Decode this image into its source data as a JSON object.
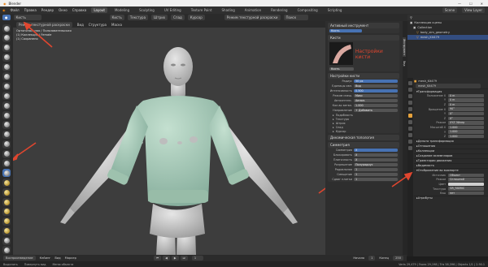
{
  "titlebar": {
    "title": "Blender",
    "controls": [
      "—",
      "☐",
      "✕"
    ]
  },
  "menubar": {
    "menus": [
      "Файл",
      "Правка",
      "Рендер",
      "Окно",
      "Справка"
    ],
    "workspaces": [
      "Layout",
      "Modeling",
      "Sculpting",
      "UV Editing",
      "Texture Paint",
      "Shading",
      "Animation",
      "Rendering",
      "Compositing",
      "Scripting"
    ],
    "active_workspace": "Layout",
    "scene": "Scene",
    "view_layer": "View Layer"
  },
  "header": {
    "brush_name": "Кисть",
    "mode": "Режим текстурной раскраски",
    "search": "Поиск",
    "items": [
      "Кисть",
      "Текстура",
      "Штрих",
      "Спад",
      "Курсор"
    ]
  },
  "viewport": {
    "header_tabs": [
      "Режим текстурной раскраски",
      "Вид",
      "Структура",
      "Маска"
    ],
    "info_lines": [
      "Ортогональная / Пользовательская",
      "(1) Коллекция | Female",
      "(1) Сохранено"
    ]
  },
  "npanel": {
    "tool_section": "Активный инструмент",
    "tool_name": "Кисть",
    "brushes_section": "Кисти",
    "brush_field": "Кисть",
    "annotation": "Настройки кисти",
    "settings_section": "Настройки кисти",
    "props": [
      {
        "label": "Радиус",
        "value": "50 px"
      },
      {
        "label": "Единицы изм.",
        "value": "Вид"
      },
      {
        "label": "Интенсивность",
        "value": "0.500"
      },
      {
        "label": "Режим смеш.",
        "value": "Микс"
      },
      {
        "label": "Автоинтенс.",
        "value": "Автом."
      },
      {
        "label": "Кол-во ветвл.",
        "value": "1.000"
      },
      {
        "label": "Направление",
        "value": "+ Добавить"
      }
    ],
    "subsections": [
      "Подобласть",
      "Текстура",
      "Штрих",
      "Спад",
      "Курсор"
    ],
    "dyntopo": "Динамическая топология",
    "symmetry_section": "Симметрия",
    "sym_props": [
      {
        "label": "Симметрия",
        "value": "X"
      },
      {
        "label": "Блокировать",
        "value": "X"
      },
      {
        "label": "Плиточность",
        "value": "X"
      },
      {
        "label": "Разрешение",
        "value": "Полурадиус"
      }
    ],
    "extra_props": [
      {
        "label": "Радиальная",
        "value": "1"
      },
      {
        "label": "Смещение",
        "value": "1"
      },
      {
        "label": "Сдвиг плитки",
        "value": "1"
      }
    ],
    "tab_labels": [
      "Инструмент",
      "Вид"
    ]
  },
  "outliner": {
    "rows": [
      "Коллекция сцены",
      "Collection",
      "body_sim_geometry",
      "mesh_Kit479"
    ],
    "selected_index": 3
  },
  "properties": {
    "object_name": "mesh_Kit479",
    "header": "mesh_Kit479",
    "transform_section": "Трансформация",
    "rows": [
      {
        "label": "Положение X",
        "value": "0 m"
      },
      {
        "label": "Y",
        "value": "0 m"
      },
      {
        "label": "Z",
        "value": "0 m"
      },
      {
        "label": "Вращение X",
        "value": "90°"
      },
      {
        "label": "Y",
        "value": "0°"
      },
      {
        "label": "Z",
        "value": "0°"
      },
      {
        "label": "Режим",
        "value": "XYZ Эйлер"
      },
      {
        "label": "Масштаб X",
        "value": "1.000"
      },
      {
        "label": "Y",
        "value": "1.000"
      },
      {
        "label": "Z",
        "value": "1.000"
      }
    ],
    "groups": [
      "Дельта трансформация",
      "Отношения",
      "Коллекции",
      "Создание экземпляров",
      "Траектории движения",
      "Видимость",
      "Отображение во вьюпорте",
      "Атрибуты"
    ],
    "bottom_rows": [
      {
        "label": "Источник",
        "value": "Объект"
      },
      {
        "label": "Режим",
        "value": "Сплошной"
      },
      {
        "label": "Цвет",
        "value": ""
      },
      {
        "label": "Текстура",
        "value": "GR_FABRIC"
      },
      {
        "label": "Кэш",
        "value": "нет"
      }
    ]
  },
  "timeline": {
    "items": [
      "Воспроизведение",
      "Кейинг",
      "Вид",
      "Маркер"
    ],
    "frame": "1",
    "start_label": "Начало",
    "start": "1",
    "end_label": "Конец",
    "end": "250"
  },
  "statusbar": {
    "items": [
      "Выделить",
      "Повернуть вид",
      "Меню объекта"
    ],
    "version": "Verts 29,479 | Faces 29,198 | Tris 58,396 | Objects 1/1 | 2.90.1"
  },
  "colors": {
    "accent": "#4772b3",
    "annotation": "#e0462f",
    "sweater": "#a8cbb8",
    "body": "#c8c8c8"
  }
}
